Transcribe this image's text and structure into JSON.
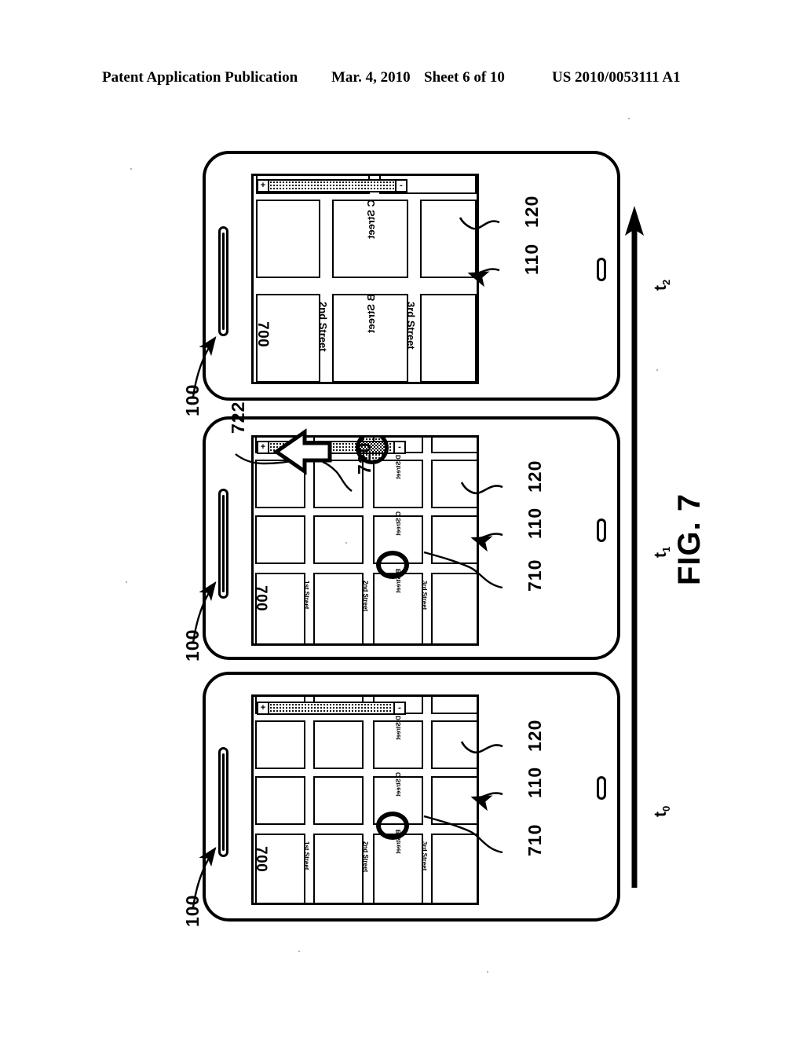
{
  "header": {
    "publication": "Patent Application Publication",
    "date": "Mar. 4, 2010",
    "sheet": "Sheet 6 of 10",
    "number": "US 2010/0053111 A1"
  },
  "figure": {
    "label": "FIG. 7",
    "timeline": {
      "t0": "t0",
      "t1": "t1",
      "t2": "t2",
      "direction": "upward-arrow"
    }
  },
  "panels": [
    {
      "id": "t0",
      "time_label": "t0",
      "device_ref": "100",
      "screen_ref": "110",
      "map_ref": "120",
      "map_label": "700",
      "marker_ref": "710",
      "zoom_level": "wide",
      "slider": {
        "zoom_in": "+",
        "zoom_out": "-",
        "handle_position": "none"
      },
      "vertical_streets": [
        "1st Street",
        "2nd Street",
        "3rd Street"
      ],
      "horizontal_streets": [
        "B Street",
        "C Street",
        "D Street"
      ]
    },
    {
      "id": "t1",
      "time_label": "t1",
      "device_ref": "100",
      "screen_ref": "110",
      "map_ref": "120",
      "map_label": "700",
      "marker_ref": "710",
      "slider_handle_ref": "720",
      "gesture_ref": "722",
      "zoom_level": "wide",
      "slider": {
        "zoom_in": "+",
        "zoom_out": "-",
        "handle_position": "mid"
      },
      "vertical_streets": [
        "1st Street",
        "2nd Street",
        "3rd Street"
      ],
      "horizontal_streets": [
        "B Street",
        "C Street",
        "D Street"
      ]
    },
    {
      "id": "t2",
      "time_label": "t2",
      "device_ref": "100",
      "screen_ref": "110",
      "map_ref": "120",
      "map_label": "700",
      "zoom_level": "zoomed-in",
      "slider": {
        "zoom_in": "+",
        "zoom_out": "-",
        "handle_position": "near-plus"
      },
      "vertical_streets": [
        "2nd Street",
        "3rd Street"
      ],
      "horizontal_streets": [
        "B Street",
        "C Street"
      ]
    }
  ],
  "colors": {
    "ink": "#000000",
    "paper": "#ffffff"
  }
}
